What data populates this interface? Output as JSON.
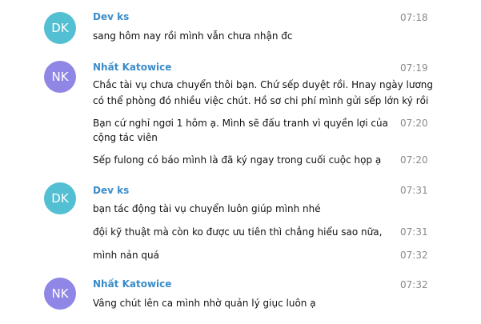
{
  "colors": {
    "name_color": "#3a8cc9",
    "avatar_dk": "#52bfd2",
    "avatar_nk": "#8f86e5",
    "time_color": "#8a8a8a"
  },
  "groups": [
    {
      "avatar": "DK",
      "sender": "Dev ks",
      "time": "07:18",
      "messages": [
        {
          "text": "sang hôm nay rồi mình vẫn chưa nhận đc",
          "time": ""
        }
      ]
    },
    {
      "avatar": "NK",
      "sender": "Nhất Katowice",
      "time": "07:19",
      "messages": [
        {
          "lines": [
            "Chắc tài vụ chưa chuyển thôi bạn. Chứ sếp duyệt rồi. Hnay ngày lương",
            "có thể phòng đó nhiều việc chút. Hồ sơ chi phí mình gửi sếp lớn ký rồi"
          ],
          "time": ""
        },
        {
          "lines": [
            "Bạn cứ nghỉ ngơi 1 hôm ạ. Mình sẽ đấu tranh vì quyền lợi của",
            "cộng tác viên"
          ],
          "time": "07:20"
        },
        {
          "text": "Sếp fulong có báo mình là đã ký ngay trong cuối cuộc họp ạ",
          "time": "07:20"
        }
      ]
    },
    {
      "avatar": "DK",
      "sender": "Dev ks",
      "time": "07:31",
      "messages": [
        {
          "text": "bạn tác động tài vụ chuyển luôn giúp mình nhé",
          "time": ""
        },
        {
          "text": "đội kỹ thuật mà còn ko được ưu tiên thì chẳng hiểu sao nữa,",
          "time": "07:31"
        },
        {
          "text": "mình nản quá",
          "time": "07:32"
        }
      ]
    },
    {
      "avatar": "NK",
      "sender": "Nhất Katowice",
      "time": "07:32",
      "messages": [
        {
          "text": "Vâng chút lên ca mình nhờ quản lý giục luôn ạ",
          "time": ""
        }
      ]
    }
  ]
}
